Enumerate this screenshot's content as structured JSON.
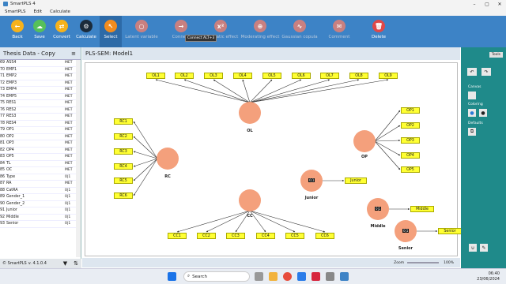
{
  "app": {
    "title": "SmartPLS 4"
  },
  "menu": [
    "SmartPLS",
    "Edit",
    "Calculate"
  ],
  "toolbar": [
    {
      "label": "Back",
      "icon": "back-icon",
      "color": "#f6b21b"
    },
    {
      "label": "Save",
      "icon": "cloud-save-icon",
      "color": "#56c05a"
    },
    {
      "label": "Convert",
      "icon": "convert-icon",
      "color": "#f6b21b"
    },
    {
      "label": "Calculate",
      "icon": "gear-icon",
      "color": "#1b2b3b"
    },
    {
      "label": "Select",
      "icon": "select-icon",
      "color": "#f28c1e"
    },
    {
      "label": "Latent variable",
      "icon": "circle-icon",
      "color": "#c98080"
    },
    {
      "label": "Connect",
      "icon": "connect-icon",
      "color": "#c98080"
    },
    {
      "label": "Quadratic effect",
      "icon": "quadratic-icon",
      "color": "#c98080"
    },
    {
      "label": "Moderating effect",
      "icon": "moderating-icon",
      "color": "#c98080"
    },
    {
      "label": "Gaussian copula",
      "icon": "gaussian-icon",
      "color": "#c98080"
    },
    {
      "label": "Comment",
      "icon": "comment-icon",
      "color": "#c98080"
    },
    {
      "label": "Delete",
      "icon": "trash-icon",
      "color": "#e04848"
    }
  ],
  "tooltip": "Connect ALT+3",
  "data_panel": {
    "title": "Thesis Data - Copy",
    "rows": [
      {
        "i": "69",
        "n": "ASS4",
        "t": "MET"
      },
      {
        "i": "70",
        "n": "EMP1",
        "t": "MET"
      },
      {
        "i": "71",
        "n": "EMP2",
        "t": "MET"
      },
      {
        "i": "72",
        "n": "EMP3",
        "t": "MET"
      },
      {
        "i": "73",
        "n": "EMP4",
        "t": "MET"
      },
      {
        "i": "74",
        "n": "EMP5",
        "t": "MET"
      },
      {
        "i": "75",
        "n": "RES1",
        "t": "MET"
      },
      {
        "i": "76",
        "n": "RES2",
        "t": "MET"
      },
      {
        "i": "77",
        "n": "RES3",
        "t": "MET"
      },
      {
        "i": "78",
        "n": "RES4",
        "t": "MET"
      },
      {
        "i": "79",
        "n": "OP1",
        "t": "MET"
      },
      {
        "i": "80",
        "n": "OP2",
        "t": "MET"
      },
      {
        "i": "81",
        "n": "OP3",
        "t": "MET"
      },
      {
        "i": "82",
        "n": "OP4",
        "t": "MET"
      },
      {
        "i": "83",
        "n": "OP5",
        "t": "MET"
      },
      {
        "i": "84",
        "n": "TL",
        "t": "MET"
      },
      {
        "i": "85",
        "n": "OC",
        "t": "MET"
      },
      {
        "i": "86",
        "n": "Type",
        "t": "0|1"
      },
      {
        "i": "87",
        "n": "RA",
        "t": "MET"
      },
      {
        "i": "88",
        "n": "CatRA",
        "t": "0|1"
      },
      {
        "i": "89",
        "n": "Gender_1",
        "t": "0|1"
      },
      {
        "i": "90",
        "n": "Gender_2",
        "t": "0|1"
      },
      {
        "i": "91",
        "n": "Junior",
        "t": "0|1"
      },
      {
        "i": "92",
        "n": "Middle",
        "t": "0|1"
      },
      {
        "i": "93",
        "n": "Senior",
        "t": "0|1"
      }
    ],
    "footer": "© SmartPLS",
    "version": "v. 4.1.0.4"
  },
  "model": {
    "title": "PLS-SEM: Model1",
    "zoom_label": "Zoom",
    "zoom": "100%"
  },
  "indicators": {
    "OL": [
      "OL1",
      "OL2",
      "OL3",
      "OL4",
      "OL5",
      "OL6",
      "OL7",
      "OL8",
      "OL9"
    ],
    "RC": [
      "RC1",
      "RC2",
      "RC3",
      "RC4",
      "RC5",
      "RC6"
    ],
    "OP": [
      "OP1",
      "OP2",
      "OP3",
      "OP4",
      "OP5"
    ],
    "CC": [
      "CC1",
      "CC2",
      "CC3",
      "CC4",
      "CC5",
      "CC6"
    ],
    "Junior": "Junior",
    "Middle": "Middle",
    "Senior": "Senior"
  },
  "latent_names": {
    "OL": "OL",
    "RC": "RC",
    "OP": "OP",
    "CC": "CC",
    "Junior": "Junior",
    "Middle": "Middle",
    "Senior": "Senior"
  },
  "lv_badge": "0|1",
  "right_panel": {
    "tab": "Tools",
    "canvas": "Canvas",
    "coloring": "Coloring",
    "defaults": "Defaults"
  },
  "taskbar": {
    "search": "Search",
    "time": "06:40",
    "date": "23/06/2024"
  }
}
